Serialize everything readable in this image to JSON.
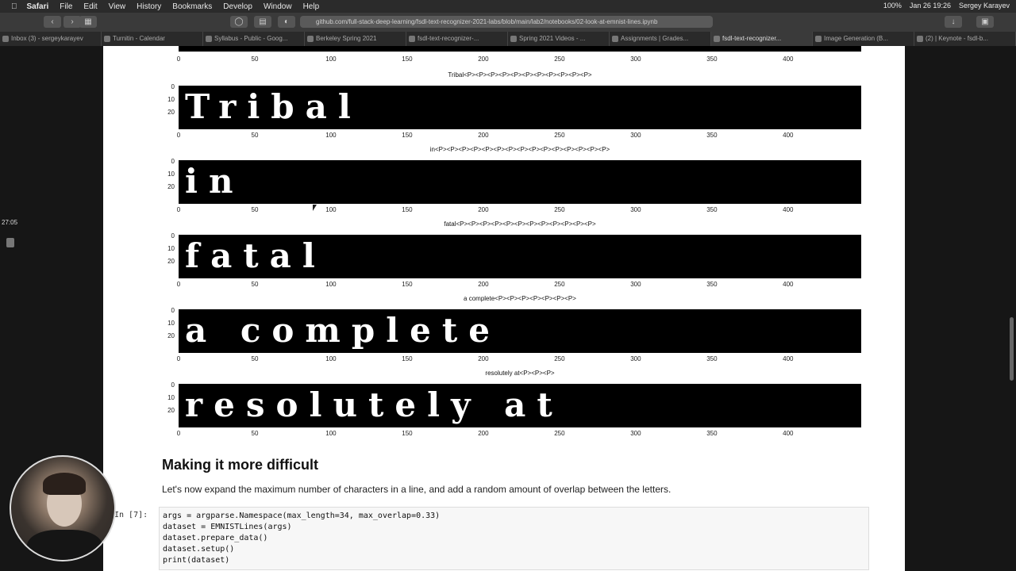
{
  "menubar": {
    "app": "Safari",
    "items": [
      "File",
      "Edit",
      "View",
      "History",
      "Bookmarks",
      "Develop",
      "Window",
      "Help"
    ],
    "battery": "100%",
    "datetime": "Jan 26  19:26",
    "user": "Sergey Karayev"
  },
  "toolbar": {
    "url": "github.com/full-stack-deep-learning/fsdl-text-recognizer-2021-labs/blob/main/lab2/notebooks/02-look-at-emnist-lines.ipynb"
  },
  "tabs": [
    "Inbox (3) - sergeykarayev",
    "Turnitin - Calendar",
    "Syllabus - Public - Goog...",
    "Berkeley Spring 2021",
    "fsdl-text-recognizer-...",
    "Spring 2021 Videos - ...",
    "Assignments | Grades...",
    "fsdl-text-recognizer...",
    "Image Generation (B...",
    "(2) | Keynote - fsdl-b..."
  ],
  "overlay": {
    "timer": "27:05"
  },
  "top_partial_ticks": [
    "0",
    "50",
    "100",
    "150",
    "200",
    "250",
    "300",
    "350",
    "400"
  ],
  "plots": [
    {
      "title": "Tribal<P><P><P><P><P><P><P><P><P><P><P>",
      "handwriting": "Tribal",
      "yticks": [
        "0",
        "10",
        "20"
      ],
      "xticks": [
        "0",
        "50",
        "100",
        "150",
        "200",
        "250",
        "300",
        "350",
        "400"
      ]
    },
    {
      "title": "in<P><P><P><P><P><P><P><P><P><P><P><P><P><P><P>",
      "handwriting": "in",
      "yticks": [
        "0",
        "10",
        "20"
      ],
      "xticks": [
        "0",
        "50",
        "100",
        "150",
        "200",
        "250",
        "300",
        "350",
        "400"
      ]
    },
    {
      "title": "fatal<P><P><P><P><P><P><P><P><P><P><P><P>",
      "handwriting": "fatal",
      "yticks": [
        "0",
        "10",
        "20"
      ],
      "xticks": [
        "0",
        "50",
        "100",
        "150",
        "200",
        "250",
        "300",
        "350",
        "400"
      ]
    },
    {
      "title": "a complete<P><P><P><P><P><P><P>",
      "handwriting": "a complete",
      "yticks": [
        "0",
        "10",
        "20"
      ],
      "xticks": [
        "0",
        "50",
        "100",
        "150",
        "200",
        "250",
        "300",
        "350",
        "400"
      ]
    },
    {
      "title": "resolutely at<P><P><P>",
      "handwriting": "resolutely at",
      "yticks": [
        "0",
        "10",
        "20"
      ],
      "xticks": [
        "0",
        "50",
        "100",
        "150",
        "200",
        "250",
        "300",
        "350",
        "400"
      ]
    }
  ],
  "section": {
    "heading": "Making it more difficult",
    "paragraph": "Let's now expand the maximum number of characters in a line, and add a random amount of overlap between the letters."
  },
  "code_cell": {
    "prompt": "In [7]:",
    "lines": [
      "args = argparse.Namespace(max_length=34, max_overlap=0.33)",
      "dataset = EMNISTLines(args)",
      "dataset.prepare_data()",
      "dataset.setup()",
      "print(dataset)"
    ]
  }
}
